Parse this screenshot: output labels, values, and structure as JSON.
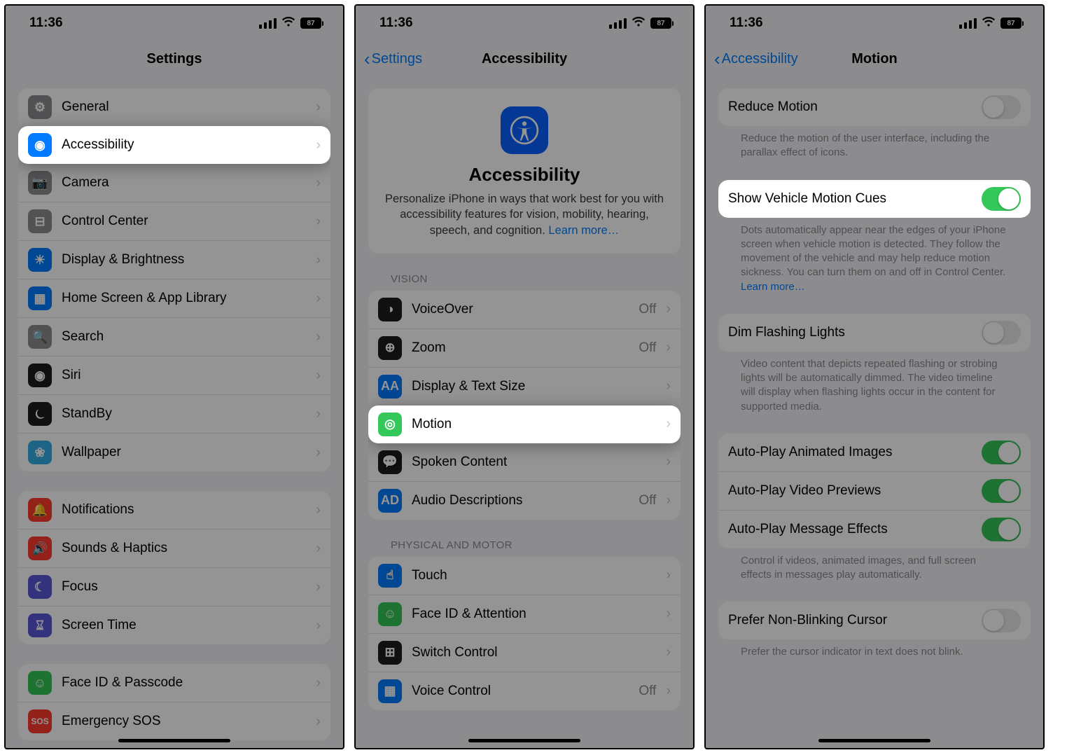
{
  "time": "11:36",
  "battery": "87",
  "screen1": {
    "title": "Settings",
    "groups": [
      {
        "items": [
          {
            "icon": "gear",
            "color": "bg-gray",
            "label": "General"
          },
          {
            "icon": "access",
            "color": "bg-blue",
            "label": "Accessibility",
            "hl": true
          },
          {
            "icon": "camera",
            "color": "bg-gray",
            "label": "Camera"
          },
          {
            "icon": "control",
            "color": "bg-gray",
            "label": "Control Center"
          },
          {
            "icon": "bright",
            "color": "bg-blue",
            "label": "Display & Brightness"
          },
          {
            "icon": "home",
            "color": "bg-blue",
            "label": "Home Screen & App Library"
          },
          {
            "icon": "search",
            "color": "bg-gray",
            "label": "Search"
          },
          {
            "icon": "siri",
            "color": "bg-black",
            "label": "Siri"
          },
          {
            "icon": "standby",
            "color": "bg-black",
            "label": "StandBy"
          },
          {
            "icon": "wall",
            "color": "bg-cyan",
            "label": "Wallpaper"
          }
        ]
      },
      {
        "items": [
          {
            "icon": "notif",
            "color": "bg-red",
            "label": "Notifications"
          },
          {
            "icon": "sound",
            "color": "bg-red",
            "label": "Sounds & Haptics"
          },
          {
            "icon": "focus",
            "color": "bg-purple",
            "label": "Focus"
          },
          {
            "icon": "screentime",
            "color": "bg-purple",
            "label": "Screen Time"
          }
        ]
      },
      {
        "items": [
          {
            "icon": "faceid",
            "color": "bg-green",
            "label": "Face ID & Passcode"
          },
          {
            "icon": "sos",
            "color": "bg-red",
            "label": "Emergency SOS"
          }
        ]
      }
    ]
  },
  "screen2": {
    "back": "Settings",
    "title": "Accessibility",
    "hero_title": "Accessibility",
    "hero_text": "Personalize iPhone in ways that work best for you with accessibility features for vision, mobility, hearing, speech, and cognition. ",
    "hero_link": "Learn more…",
    "sections": [
      {
        "header": "VISION",
        "items": [
          {
            "icon": "voiceover",
            "color": "bg-black",
            "label": "VoiceOver",
            "detail": "Off"
          },
          {
            "icon": "zoom",
            "color": "bg-black",
            "label": "Zoom",
            "detail": "Off"
          },
          {
            "icon": "textsize",
            "color": "bg-blue",
            "label": "Display & Text Size"
          },
          {
            "icon": "motion",
            "color": "bg-green",
            "label": "Motion",
            "hl": true
          },
          {
            "icon": "spoken",
            "color": "bg-black",
            "label": "Spoken Content"
          },
          {
            "icon": "audiodesc",
            "color": "bg-blue",
            "label": "Audio Descriptions",
            "detail": "Off"
          }
        ]
      },
      {
        "header": "PHYSICAL AND MOTOR",
        "items": [
          {
            "icon": "touch",
            "color": "bg-blue",
            "label": "Touch"
          },
          {
            "icon": "faceatt",
            "color": "bg-green",
            "label": "Face ID & Attention"
          },
          {
            "icon": "switch",
            "color": "bg-black",
            "label": "Switch Control"
          },
          {
            "icon": "voicectl",
            "color": "bg-blue",
            "label": "Voice Control",
            "detail": "Off"
          }
        ]
      }
    ]
  },
  "screen3": {
    "back": "Accessibility",
    "title": "Motion",
    "rows": [
      {
        "type": "toggle",
        "label": "Reduce Motion",
        "on": false,
        "footer": "Reduce the motion of the user interface, including the parallax effect of icons."
      },
      {
        "type": "toggle",
        "label": "Show Vehicle Motion Cues",
        "on": true,
        "hl": true,
        "footer": "Dots automatically appear near the edges of your iPhone screen when vehicle motion is detected. They follow the movement of the vehicle and may help reduce motion sickness. You can turn them on and off in Control Center. ",
        "footer_link": "Learn more…"
      },
      {
        "type": "toggle",
        "label": "Dim Flashing Lights",
        "on": false,
        "footer": "Video content that depicts repeated flashing or strobing lights will be automatically dimmed. The video timeline will display when flashing lights occur in the content for supported media."
      },
      {
        "type": "toggle-group",
        "items": [
          {
            "label": "Auto-Play Animated Images",
            "on": true
          },
          {
            "label": "Auto-Play Video Previews",
            "on": true
          },
          {
            "label": "Auto-Play Message Effects",
            "on": true
          }
        ],
        "footer": "Control if videos, animated images, and full screen effects in messages play automatically."
      },
      {
        "type": "toggle",
        "label": "Prefer Non-Blinking Cursor",
        "on": false,
        "footer": "Prefer the cursor indicator in text does not blink."
      }
    ]
  }
}
